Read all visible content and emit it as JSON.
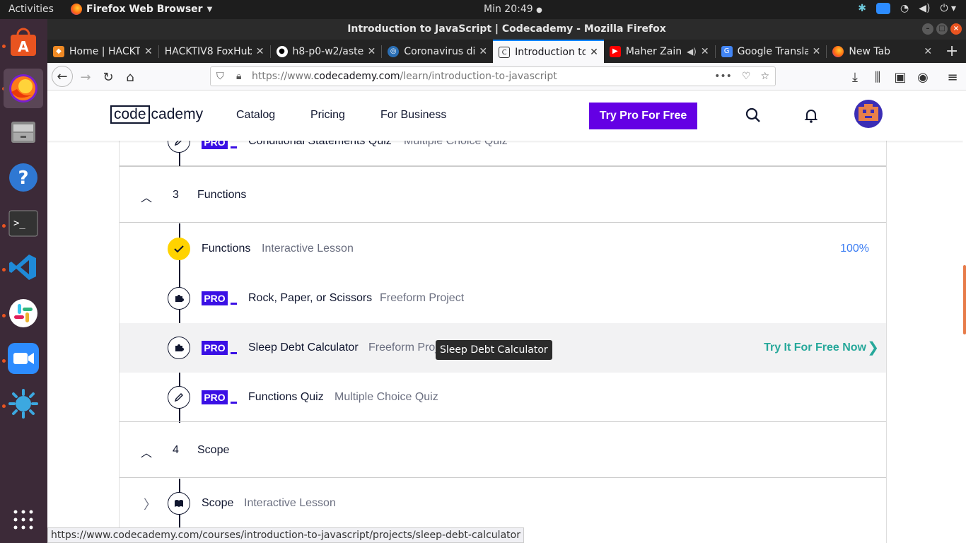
{
  "system": {
    "activities": "Activities",
    "app_menu": "Firefox Web Browser",
    "clock": "Min 20:49"
  },
  "window": {
    "title": "Introduction to JavaScript | Codecademy - Mozilla Firefox"
  },
  "tabs": [
    {
      "label": "Home | HACKT",
      "icon": "hacktiv-icon"
    },
    {
      "label": "HACKTIV8 FoxHub",
      "icon": "none"
    },
    {
      "label": "h8-p0-w2/aste",
      "icon": "github-icon"
    },
    {
      "label": "Coronavirus di",
      "icon": "globe-icon"
    },
    {
      "label": "Introduction to",
      "icon": "codecademy-icon",
      "active": true
    },
    {
      "label": "Maher Zain",
      "icon": "youtube-icon"
    },
    {
      "label": "Google Transla",
      "icon": "google-translate-icon"
    },
    {
      "label": "New Tab",
      "icon": "firefox-icon"
    }
  ],
  "urlbar": {
    "prefix": "https://www.",
    "host": "codecademy.com",
    "path": "/learn/introduction-to-javascript"
  },
  "header": {
    "logo_box": "code",
    "logo_rest": "cademy",
    "nav": [
      "Catalog",
      "Pricing",
      "For Business"
    ],
    "cta": "Try Pro For Free"
  },
  "syllabus": {
    "prev_item": {
      "badge": "PRO",
      "title": "Conditional Statements Quiz",
      "type": "Multiple Choice Quiz"
    },
    "section3": {
      "num": "3",
      "title": "Functions"
    },
    "items": [
      {
        "title": "Functions",
        "type": "Interactive Lesson",
        "progress": "100%",
        "status": "done"
      },
      {
        "badge": "PRO",
        "title": "Rock, Paper, or Scissors",
        "type": "Freeform Project"
      },
      {
        "badge": "PRO",
        "title": "Sleep Debt Calculator",
        "type": "Freeform Project",
        "action": "Try It For Free Now"
      },
      {
        "badge": "PRO",
        "title": "Functions Quiz",
        "type": "Multiple Choice Quiz"
      }
    ],
    "section4": {
      "num": "4",
      "title": "Scope"
    },
    "scope_item": {
      "title": "Scope",
      "type": "Interactive Lesson"
    }
  },
  "tooltip": "Sleep Debt Calculator",
  "status_url": "https://www.codecademy.com/courses/introduction-to-javascript/projects/sleep-debt-calculator",
  "colors": {
    "accent": "#6400e4",
    "pro": "#3a10e5",
    "check": "#ffd300",
    "try": "#26a89a",
    "progress": "#3a7cf3"
  }
}
